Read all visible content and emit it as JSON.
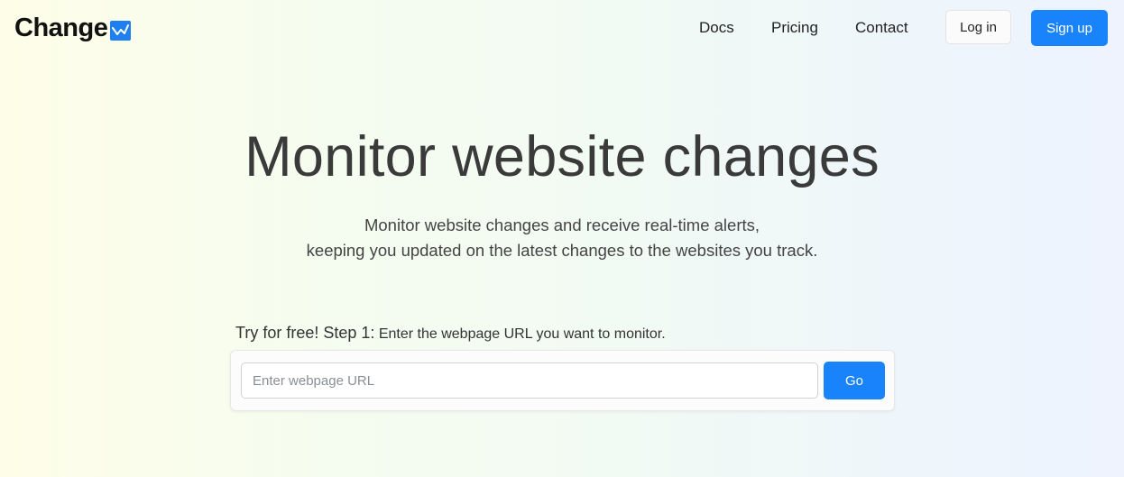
{
  "header": {
    "logo_text": "Change",
    "nav": [
      {
        "label": "Docs"
      },
      {
        "label": "Pricing"
      },
      {
        "label": "Contact"
      }
    ],
    "login_label": "Log in",
    "signup_label": "Sign up"
  },
  "hero": {
    "title": "Monitor website changes",
    "subtitle_line1": "Monitor website changes and receive real-time alerts,",
    "subtitle_line2": "keeping you updated on the latest changes to the websites you track."
  },
  "step": {
    "lead": "Try for free! Step 1:",
    "text": " Enter the webpage URL you want to monitor."
  },
  "url_form": {
    "input_value": "",
    "input_placeholder": "Enter webpage URL",
    "go_label": "Go"
  },
  "icons": {
    "logo": "chart-trend-icon"
  },
  "colors": {
    "primary": "#1883fb",
    "title_text": "#3a3a3a",
    "logo_icon_bg": "#1f7ef0"
  }
}
